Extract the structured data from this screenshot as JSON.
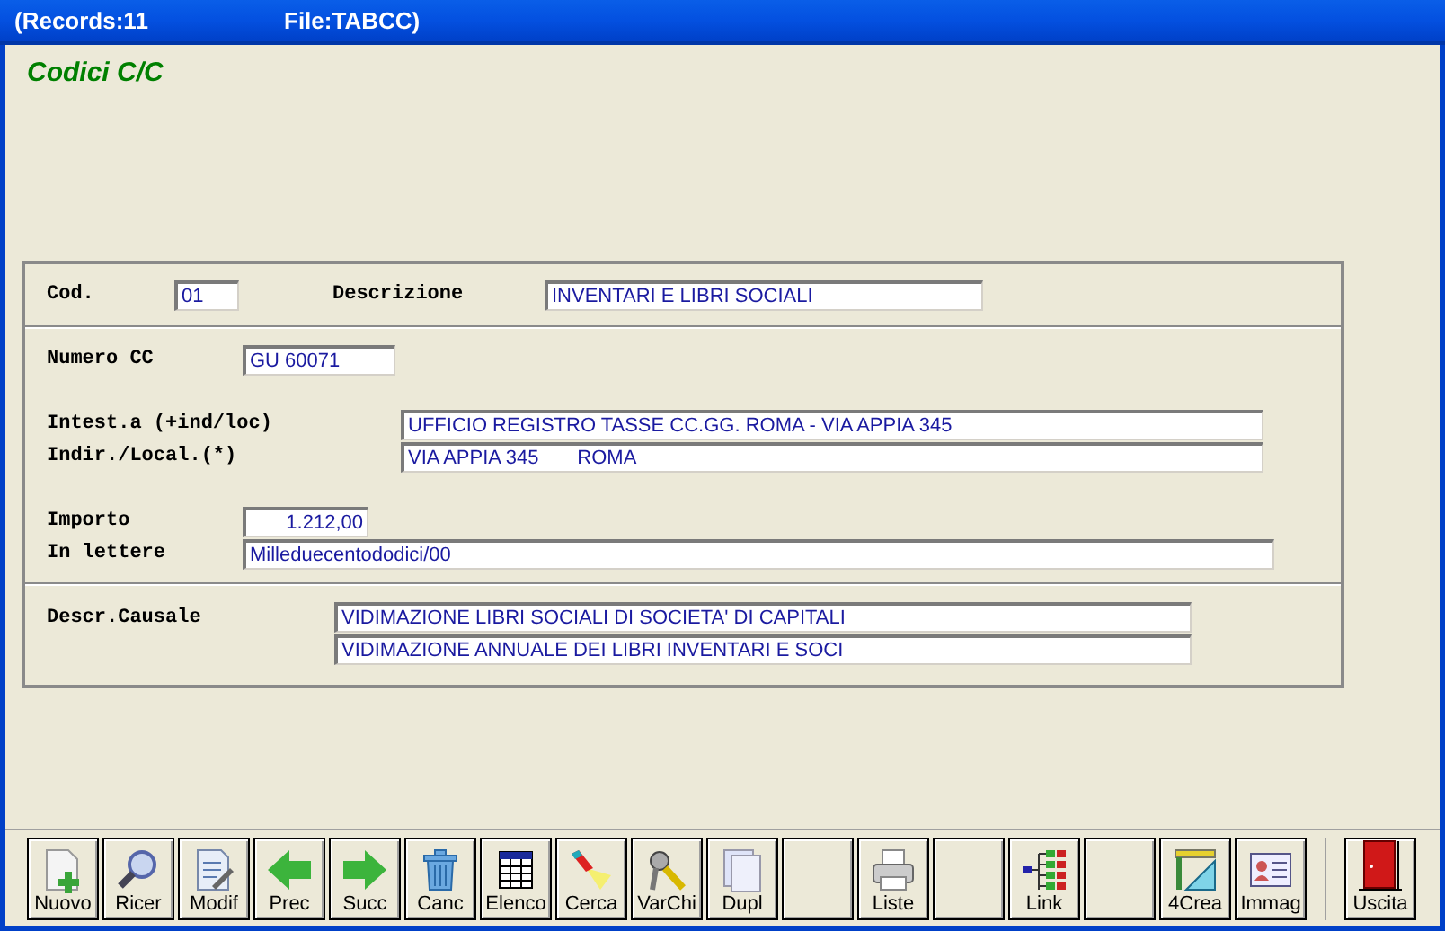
{
  "window": {
    "records": "(Records:11",
    "file": "File:TABCC)"
  },
  "heading": "Codici C/C",
  "form": {
    "cod": {
      "label": "Cod.",
      "value": "01"
    },
    "descrizione": {
      "label": "Descrizione",
      "value": "INVENTARI E LIBRI SOCIALI"
    },
    "numero_cc": {
      "label": "Numero CC",
      "value": "GU 60071"
    },
    "intestazione": {
      "label": "Intest.a (+ind/loc)",
      "value": "UFFICIO REGISTRO TASSE CC.GG. ROMA - VIA APPIA 345"
    },
    "indirizzo": {
      "label": "Indir./Local.(*)",
      "value": "VIA APPIA 345       ROMA"
    },
    "importo": {
      "label": "Importo",
      "value": "1.212,00"
    },
    "in_lettere": {
      "label": "In lettere",
      "value": "Milleduecentododici/00"
    },
    "causale": {
      "label": "Descr.Causale",
      "lines": [
        "VIDIMAZIONE LIBRI SOCIALI DI SOCIETA' DI CAPITALI",
        "VIDIMAZIONE ANNUALE DEI LIBRI INVENTARI E SOCI"
      ]
    }
  },
  "toolbar": [
    {
      "kind": "new",
      "label": "Nuovo"
    },
    {
      "kind": "search",
      "label": "Ricer"
    },
    {
      "kind": "edit",
      "label": "Modif"
    },
    {
      "kind": "prev",
      "label": "Prec"
    },
    {
      "kind": "next",
      "label": "Succ"
    },
    {
      "kind": "delete",
      "label": "Canc"
    },
    {
      "kind": "list",
      "label": "Elenco"
    },
    {
      "kind": "find",
      "label": "Cerca"
    },
    {
      "kind": "keys",
      "label": "VarChi"
    },
    {
      "kind": "copy",
      "label": "Dupl"
    },
    {
      "kind": "blank"
    },
    {
      "kind": "print",
      "label": "Liste"
    },
    {
      "kind": "blank"
    },
    {
      "kind": "link",
      "label": "Link"
    },
    {
      "kind": "blank"
    },
    {
      "kind": "create",
      "label": "4Crea"
    },
    {
      "kind": "image",
      "label": "Immag"
    },
    {
      "kind": "exit",
      "label": "Uscita"
    }
  ]
}
